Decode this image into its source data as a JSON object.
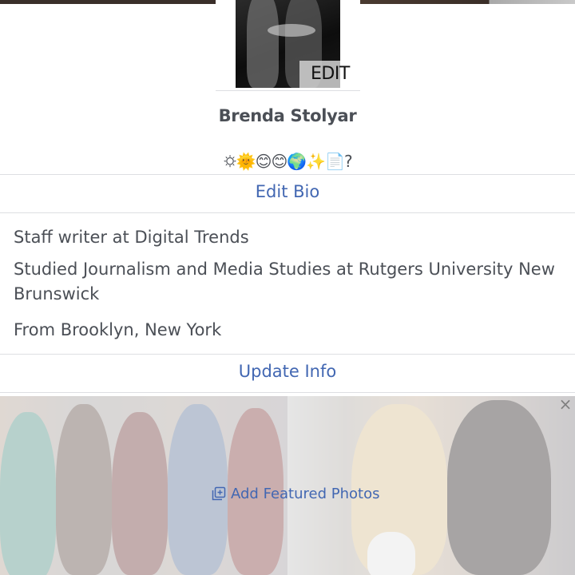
{
  "profile": {
    "photo_edit_label": "EDIT",
    "name": "Brenda Stolyar",
    "emoji_bio": "🌣🌞😊😊🌍✨📄?"
  },
  "actions": {
    "edit_bio": "Edit Bio",
    "update_info": "Update Info"
  },
  "info": {
    "work": "Staff writer at Digital Trends",
    "education": "Studied Journalism and Media Studies at Rutgers University New Brunswick",
    "hometown": "From Brooklyn, New York"
  },
  "featured": {
    "add_label": "Add Featured Photos",
    "icon": "add-photo-icon",
    "close_icon": "close-icon"
  },
  "colors": {
    "link": "#4267b2",
    "text": "#4b4f56",
    "divider": "#dddfe2"
  }
}
